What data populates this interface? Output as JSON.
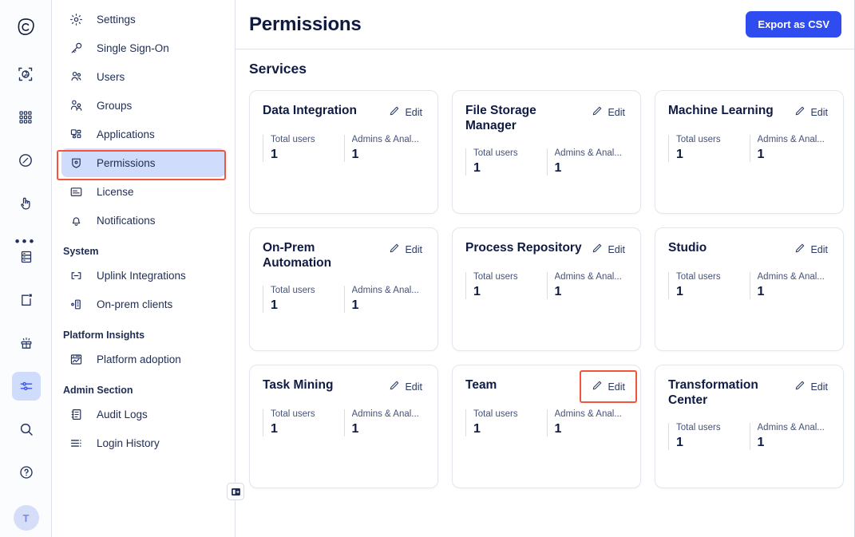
{
  "rail": {
    "logo_name": "app-logo",
    "items": [
      {
        "name": "rail-icon-automation",
        "active": false
      },
      {
        "name": "rail-icon-apps-grid",
        "active": false
      },
      {
        "name": "rail-icon-compass",
        "active": false
      },
      {
        "name": "rail-icon-click",
        "active": false
      }
    ],
    "more_label": "•••",
    "bottom_items": [
      {
        "name": "rail-icon-database",
        "active": false
      },
      {
        "name": "rail-icon-document",
        "active": false
      },
      {
        "name": "rail-icon-gift",
        "active": false
      },
      {
        "name": "rail-icon-admin-sliders",
        "active": true
      },
      {
        "name": "rail-icon-search",
        "active": false
      },
      {
        "name": "rail-icon-help",
        "active": false
      }
    ],
    "avatar_initial": "T"
  },
  "sidebar": {
    "items": [
      {
        "label": "Settings",
        "icon": "gear-icon",
        "selected": false
      },
      {
        "label": "Single Sign-On",
        "icon": "key-icon",
        "selected": false
      },
      {
        "label": "Users",
        "icon": "users-icon",
        "selected": false
      },
      {
        "label": "Groups",
        "icon": "groups-icon",
        "selected": false
      },
      {
        "label": "Applications",
        "icon": "applications-icon",
        "selected": false
      },
      {
        "label": "Permissions",
        "icon": "shield-icon",
        "selected": true
      },
      {
        "label": "License",
        "icon": "license-card-icon",
        "selected": false
      },
      {
        "label": "Notifications",
        "icon": "bell-icon",
        "selected": false
      }
    ],
    "groups": [
      {
        "title": "System",
        "items": [
          {
            "label": "Uplink Integrations",
            "icon": "uplink-icon"
          },
          {
            "label": "On-prem clients",
            "icon": "on-prem-client-icon"
          }
        ]
      },
      {
        "title": "Platform Insights",
        "items": [
          {
            "label": "Platform adoption",
            "icon": "chart-report-icon"
          }
        ]
      },
      {
        "title": "Admin Section",
        "items": [
          {
            "label": "Audit Logs",
            "icon": "audit-log-icon"
          },
          {
            "label": "Login History",
            "icon": "login-history-icon"
          }
        ]
      }
    ],
    "collapse_toggle_name": "collapse-sidebar-toggle"
  },
  "header": {
    "title": "Permissions",
    "export_label": "Export as CSV"
  },
  "content": {
    "section_title": "Services",
    "edit_label": "Edit",
    "stat_labels": {
      "total_users": "Total users",
      "admins_analysts": "Admins & Anal..."
    },
    "cards": [
      {
        "title": "Data Integration",
        "total_users": "1",
        "admins_analysts": "1",
        "highlighted": false
      },
      {
        "title": "File Storage Manager",
        "total_users": "1",
        "admins_analysts": "1",
        "highlighted": false
      },
      {
        "title": "Machine Learning",
        "total_users": "1",
        "admins_analysts": "1",
        "highlighted": false
      },
      {
        "title": "On-Prem Automation",
        "total_users": "1",
        "admins_analysts": "1",
        "highlighted": false
      },
      {
        "title": "Process Repository",
        "total_users": "1",
        "admins_analysts": "1",
        "highlighted": false
      },
      {
        "title": "Studio",
        "total_users": "1",
        "admins_analysts": "1",
        "highlighted": false
      },
      {
        "title": "Task Mining",
        "total_users": "1",
        "admins_analysts": "1",
        "highlighted": false
      },
      {
        "title": "Team",
        "total_users": "1",
        "admins_analysts": "1",
        "highlighted": true
      },
      {
        "title": "Transformation Center",
        "total_users": "1",
        "admins_analysts": "1",
        "highlighted": false
      }
    ]
  },
  "colors": {
    "accent_blue": "#2f4cf0",
    "selected_bg": "#cfdcfb",
    "highlight_red": "#f4543c",
    "text_dark": "#101b43"
  }
}
